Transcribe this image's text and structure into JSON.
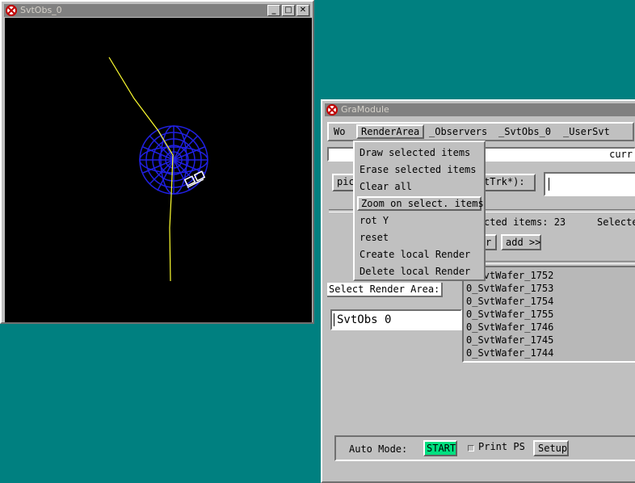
{
  "svt_window": {
    "title": "SvtObs_0"
  },
  "gra_window": {
    "title": "GraModule",
    "menubar": [
      {
        "label": "Wo"
      },
      {
        "label": "RenderArea"
      },
      {
        "label": "_Observers"
      },
      {
        "label": "_SvtObs_0"
      },
      {
        "label": "_UserSvt"
      }
    ],
    "dropdown": [
      {
        "label": "Draw selected items"
      },
      {
        "label": "Erase selected items"
      },
      {
        "label": "Clear all"
      },
      {
        "label": "Zoom on select. items"
      },
      {
        "label": "rot Y"
      },
      {
        "label": "reset"
      },
      {
        "label": "Create local Render"
      },
      {
        "label": "Delete local Render"
      }
    ],
    "status_right": "curr",
    "pick_button": "pic",
    "pattern_label": "tTrk*):",
    "selected_items_text": "cted items: 23",
    "selected_right": "Selecte",
    "partial_button": "r",
    "add_button": "add >>",
    "select_render_label": "Select Render Area:",
    "render_area_value": "SvtObs 0",
    "wafer_list": [
      "0_SvtWafer_1752",
      "0_SvtWafer_1753",
      "0_SvtWafer_1754",
      "0_SvtWafer_1755",
      "0_SvtWafer_1746",
      "0_SvtWafer_1745",
      "0_SvtWafer_1744"
    ],
    "auto_mode_label": "Auto Mode:",
    "start_button": "START",
    "print_ps_label": "Print PS",
    "setup_button": "Setup"
  },
  "colors": {
    "desktop": "#008080",
    "window_bg": "#c0c0c0",
    "start_green": "#00e080",
    "detector_blue": "#2020e0",
    "track_yellow": "#ffff30"
  }
}
